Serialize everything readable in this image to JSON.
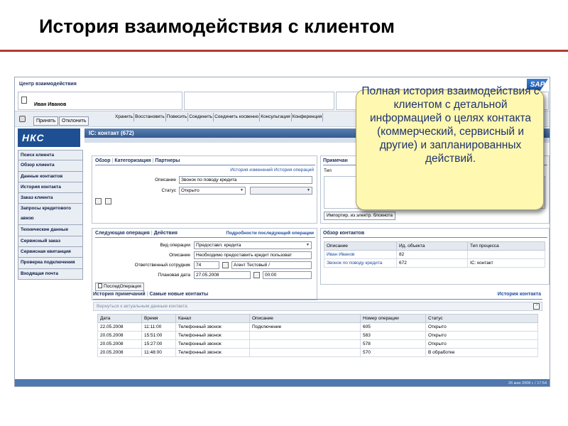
{
  "slide": {
    "title": "История взаимодействия с клиентом"
  },
  "callout": {
    "text": "Полная история взаимодействия с клиентом с детальной информацией о целях контакта (коммерческий, сервисный и другие)  и запланированных действий."
  },
  "app": {
    "header_title": "Центр взаимодействия",
    "customer_name": "Иван Иванов",
    "logo_text": "SAP",
    "nav_logo_text": "НКС",
    "toolbar": {
      "accept": "Принять",
      "decline": "Отклонить",
      "links": [
        "Хранить",
        "Восстановить",
        "Повесить",
        "Соединить",
        "Соединить косвенно",
        "Консультация",
        "Конференция"
      ]
    },
    "nav_items": [
      "Поиск клиента",
      "Обзор клиента",
      "Данные контактов",
      "История контакта",
      "Заказ клиента",
      "Запросы кредитового авизо",
      "Технические данные",
      "Сервисный заказ",
      "Сервисная квитанция",
      "Проверка подключения",
      "Входящая почта"
    ],
    "main_bar_title": "IC: контакт (672)",
    "overview": {
      "tabs": [
        "Обзор",
        "Категоризация",
        "Партнеры"
      ],
      "links": [
        "История изменений",
        "История операций"
      ],
      "description_label": "Описание",
      "description_value": "Звонок по поводу кредита",
      "status_label": "Статус",
      "status_value": "Открыто"
    },
    "notes": {
      "title": "Примечан",
      "type_label": "Тип",
      "import_button": "Импортир. из электр. блокнота"
    },
    "next_op": {
      "tabs": [
        "Следующая операция",
        "Действия"
      ],
      "details_link": "Подробности последующей операции",
      "op_type_label": "Вид операции",
      "op_type_value": "Предоставл. кредита",
      "description_label": "Описание",
      "description_value": "Необходимо предоставить кредит пользоват",
      "employee_label": "Ответственный сотрудник",
      "employee_id": "74",
      "employee_name": "Агент Тестовый /",
      "date_label": "Плановая дата",
      "date_value": "27.05.2008",
      "time_value": "00:00",
      "followup_button": "ПоследОперация"
    },
    "contacts_overview": {
      "title": "Обзор контактов",
      "columns": [
        "Описание",
        "Ид. объекта",
        "Тип процесса"
      ],
      "rows": [
        [
          "Иван Иванов",
          "82",
          ""
        ],
        [
          "Звонок по поводу кредита",
          "672",
          "IC: контакт"
        ]
      ]
    },
    "history": {
      "tabs": [
        "История примечаний",
        "Самые новые контакты"
      ],
      "right_link": "История контакта",
      "back_text": "Вернуться к актуальным данным контакта",
      "columns": [
        "Дата",
        "Время",
        "Канал",
        "Описание",
        "Номер операции",
        "Статус"
      ],
      "rows": [
        [
          "22.05.2008",
          "11:11:00",
          "Телефонный звонок",
          "Подключение",
          "605",
          "Открыто"
        ],
        [
          "20.05.2008",
          "15:51:00",
          "Телефонный звонок",
          "",
          "583",
          "Открыто"
        ],
        [
          "20.05.2008",
          "15:27:00",
          "Телефонный звонок",
          "",
          "578",
          "Открыто"
        ],
        [
          "20.05.2008",
          "11:48:00",
          "Телефонный звонок",
          "",
          "570",
          "В обработке"
        ]
      ]
    },
    "status_bar_text": "26 мая 2008 г. / 17:54"
  }
}
